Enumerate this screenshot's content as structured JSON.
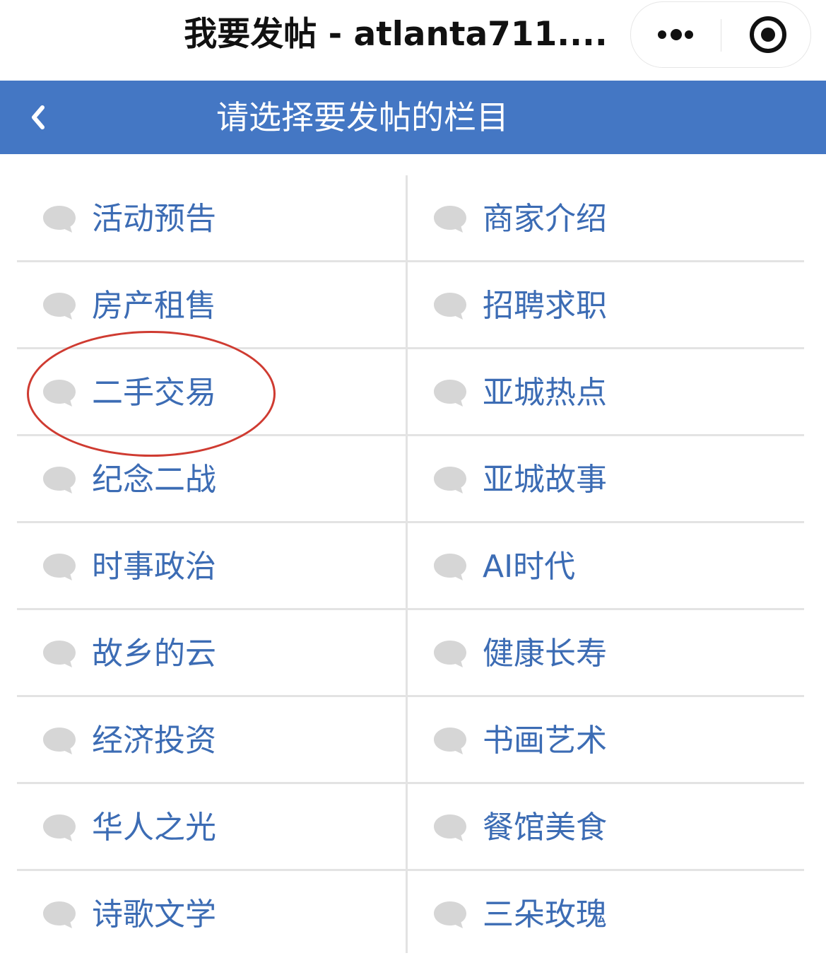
{
  "window": {
    "title": "我要发帖 - atlanta711....",
    "more_icon": "more-dots-icon",
    "close_icon": "target-close-icon"
  },
  "nav": {
    "title": "请选择要发帖的栏目",
    "back_icon": "chevron-left-icon",
    "color": "#4477c4"
  },
  "categories": {
    "left": [
      "活动预告",
      "房产租售",
      "二手交易",
      "纪念二战",
      "时事政治",
      "故乡的云",
      "经济投资",
      "华人之光",
      "诗歌文学"
    ],
    "right": [
      "商家介绍",
      "招聘求职",
      "亚城热点",
      "亚城故事",
      "AI时代",
      "健康长寿",
      "书画艺术",
      "餐馆美食",
      "三朵玫瑰"
    ],
    "item_icon": "chat-bubble-icon",
    "label_color": "#3c6cb4"
  },
  "annotation": {
    "highlighted_item": "二手交易",
    "color": "#cf3b31"
  }
}
